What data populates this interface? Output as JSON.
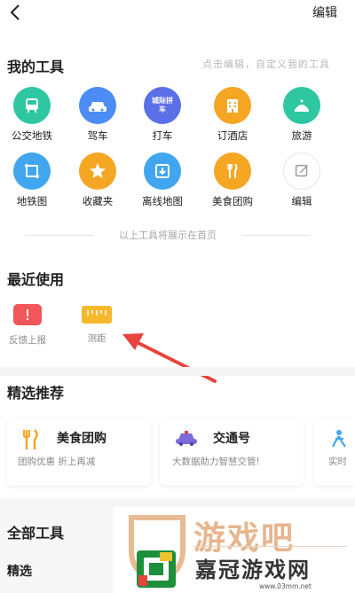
{
  "header": {
    "edit_label": "编辑"
  },
  "my_tools": {
    "title": "我的工具",
    "hint": "点击编辑，自定义我的工具",
    "items": [
      {
        "label": "公交地铁",
        "icon": "bus-icon",
        "color": "#2ec7a1"
      },
      {
        "label": "驾车",
        "icon": "car-icon",
        "color": "#4b8cf5"
      },
      {
        "label": "打车",
        "icon": "taxi-icon",
        "color": "#5b6fe6",
        "badge": "城际拼车"
      },
      {
        "label": "订酒店",
        "icon": "hotel-icon",
        "color": "#f5a623"
      },
      {
        "label": "旅游",
        "icon": "travel-icon",
        "color": "#2ec7a1"
      },
      {
        "label": "地铁图",
        "icon": "subway-map-icon",
        "color": "#41a6ef"
      },
      {
        "label": "收藏夹",
        "icon": "star-icon",
        "color": "#f5a623"
      },
      {
        "label": "离线地图",
        "icon": "offline-map-icon",
        "color": "#41a6ef"
      },
      {
        "label": "美食团购",
        "icon": "food-icon",
        "color": "#f5a623"
      },
      {
        "label": "编辑",
        "icon": "edit-icon",
        "color": "#ffffff"
      }
    ]
  },
  "divider_text": "以上工具将展示在首页",
  "recent": {
    "title": "最近使用",
    "items": [
      {
        "label": "反馈上报",
        "icon": "feedback-icon",
        "color": "#f0565a"
      },
      {
        "label": "测距",
        "icon": "ruler-icon",
        "color": "#f5b72c"
      }
    ]
  },
  "featured": {
    "title": "精选推荐",
    "cards": [
      {
        "title": "美食团购",
        "subtitle": "团购优惠 折上再减",
        "icon": "food-icon"
      },
      {
        "title": "交通号",
        "subtitle": "大数据助力智慧交管!",
        "icon": "police-car-icon"
      },
      {
        "title": "",
        "subtitle": "实时",
        "icon": "person-icon"
      }
    ]
  },
  "all_tools": {
    "title": "全部工具",
    "category": "精选"
  },
  "watermark": {
    "big_text": "游戏吧",
    "sub_text": "嘉冠游戏网",
    "url": "www.03mm.net"
  },
  "colors": {
    "accent_arrow": "#e8433f",
    "watermark_orange": "#e3aa7b"
  }
}
